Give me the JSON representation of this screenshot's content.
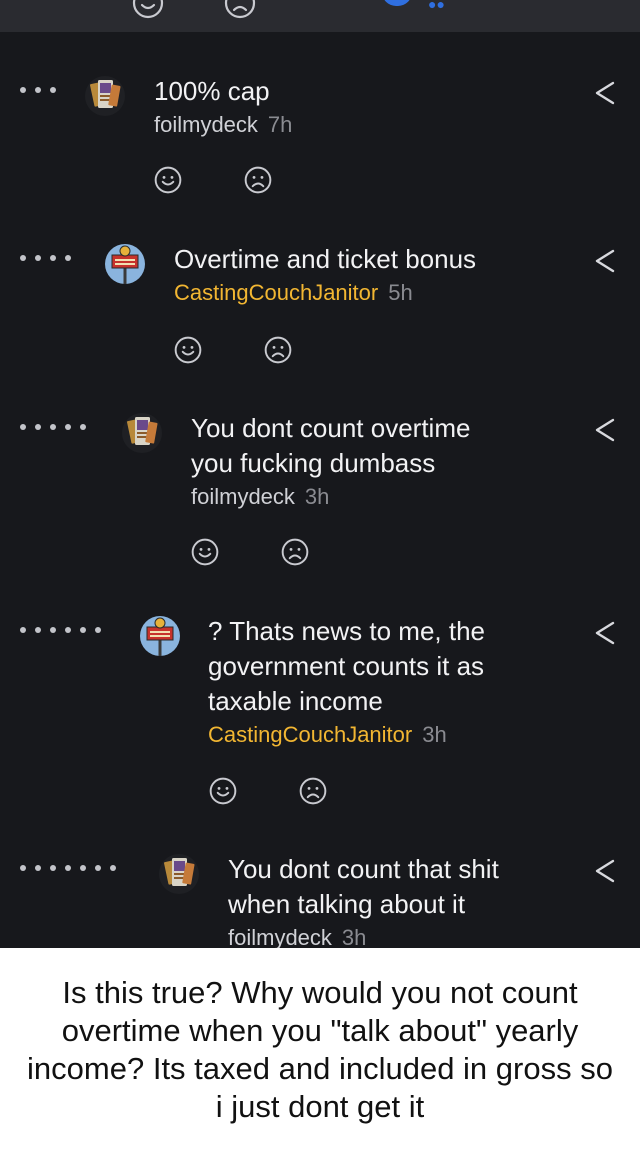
{
  "comments": [
    {
      "text_lines": [
        "100% cap"
      ],
      "author": "foilmydeck",
      "time": "7h"
    },
    {
      "text_lines": [
        "Overtime and ticket bonus"
      ],
      "author": "CastingCouchJanitor",
      "time": "5h"
    },
    {
      "text_lines": [
        "You dont count overtime",
        "you fucking dumbass"
      ],
      "author": "foilmydeck",
      "time": "3h"
    },
    {
      "text_lines": [
        "? Thats news to me, the",
        "government counts it as",
        "taxable income"
      ],
      "author": "CastingCouchJanitor",
      "time": "3h"
    },
    {
      "text_lines": [
        "You dont count that shit",
        "when talking about it"
      ],
      "author": "foilmydeck",
      "time": "3h"
    }
  ],
  "caption": "Is this true? Why would you not count overtime when you \"talk about\" yearly income? Its taxed and included in gross so i just dont get it",
  "colors": {
    "background": "#17181c",
    "author_op": "#d0d1d6",
    "author_highlight": "#f2b632",
    "timestamp": "#8a8b91",
    "caption_bg": "#ffffff"
  },
  "icons": {
    "thread_depth": "dot-icon",
    "avatar_a": "cards-avatar-icon",
    "avatar_b": "sign-avatar-icon",
    "share": "share-icon",
    "upvote": "smile-icon",
    "downvote": "frown-icon"
  }
}
